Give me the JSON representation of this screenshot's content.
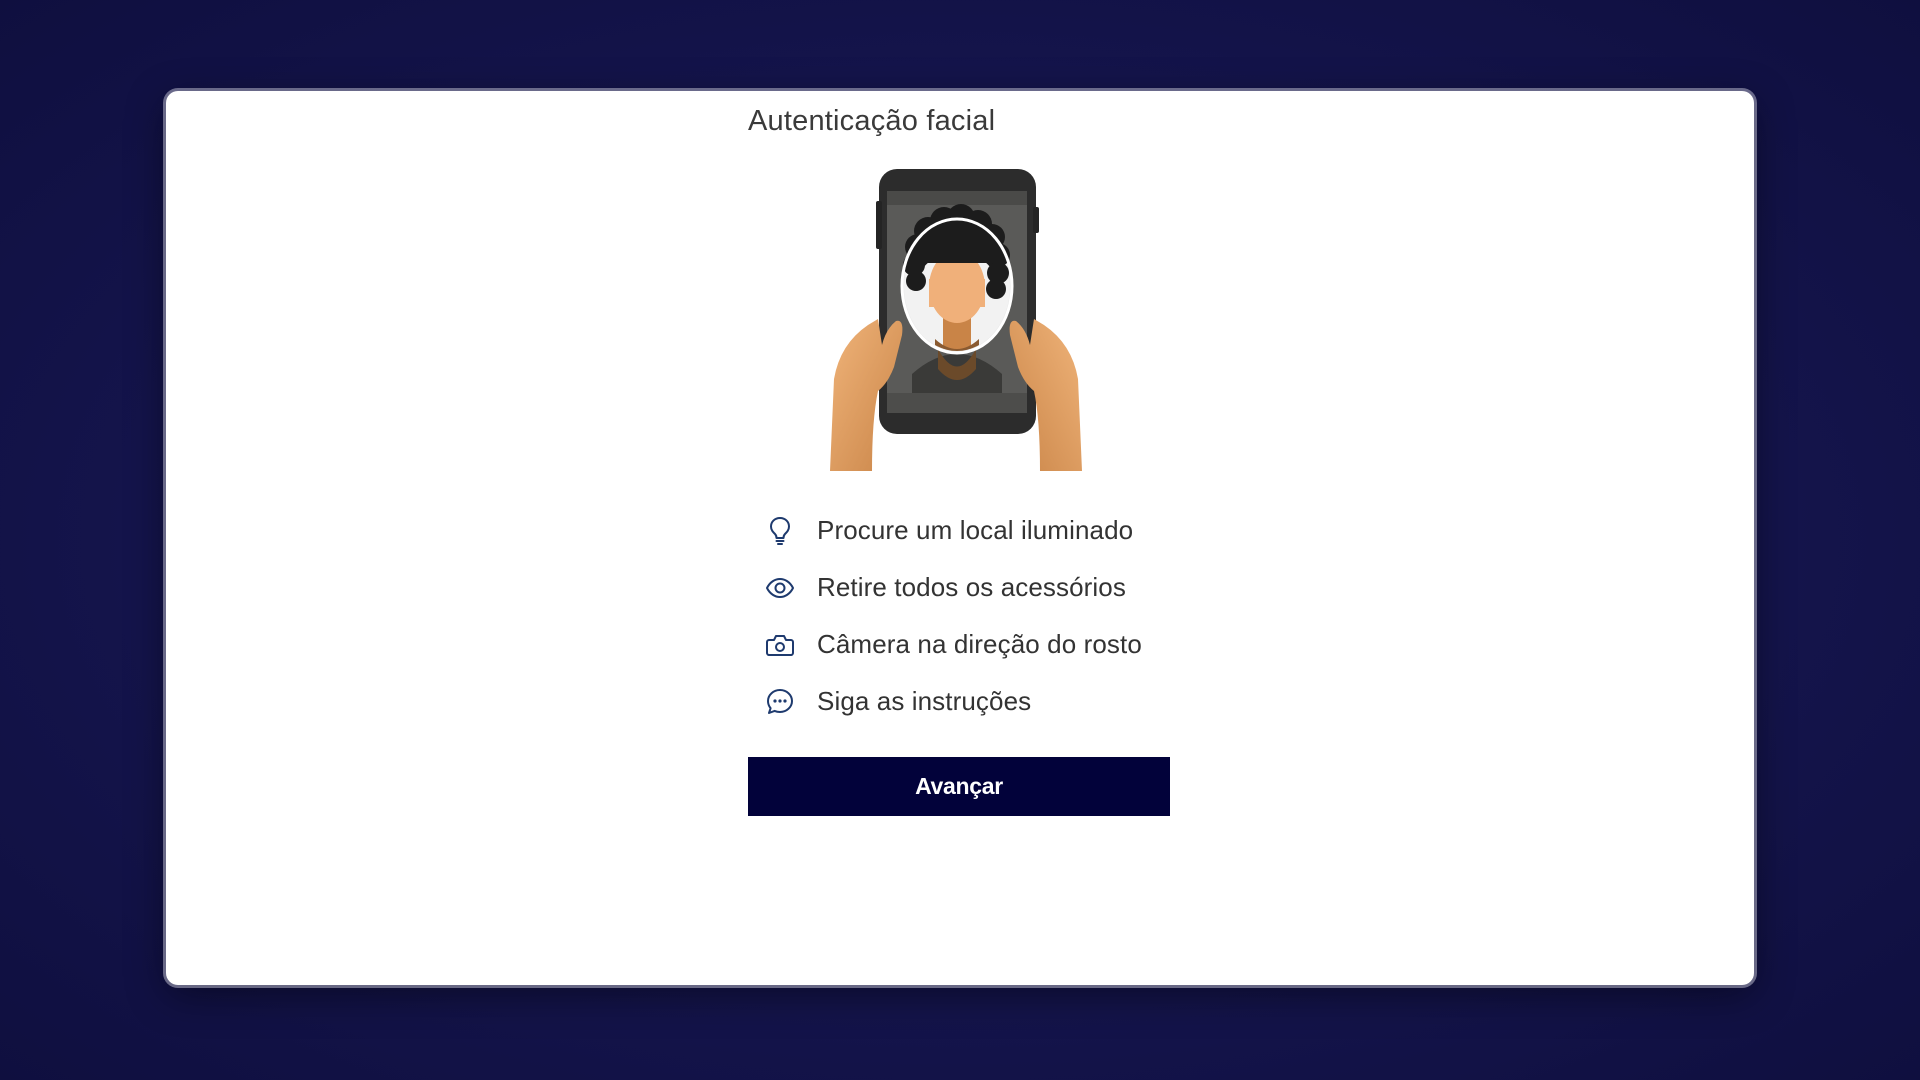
{
  "dialog": {
    "title": "Autenticação facial"
  },
  "illustration": {
    "name": "person-holding-phone-selfie",
    "colors": {
      "phone": "#2c2c2c",
      "screen": "#5a5a58",
      "skin": "#e8a56a",
      "hair": "#1c1c1c"
    }
  },
  "instructions": [
    {
      "icon": "lightbulb-icon",
      "label": "Procure um local iluminado"
    },
    {
      "icon": "eye-icon",
      "label": "Retire todos os acessórios"
    },
    {
      "icon": "camera-icon",
      "label": "Câmera na direção do rosto"
    },
    {
      "icon": "chat-bubble-icon",
      "label": "Siga as instruções"
    }
  ],
  "actions": {
    "next_label": "Avançar"
  },
  "colors": {
    "background": "#16164f",
    "primary_button": "#02023a",
    "icon_accent": "#1e3a6e"
  }
}
